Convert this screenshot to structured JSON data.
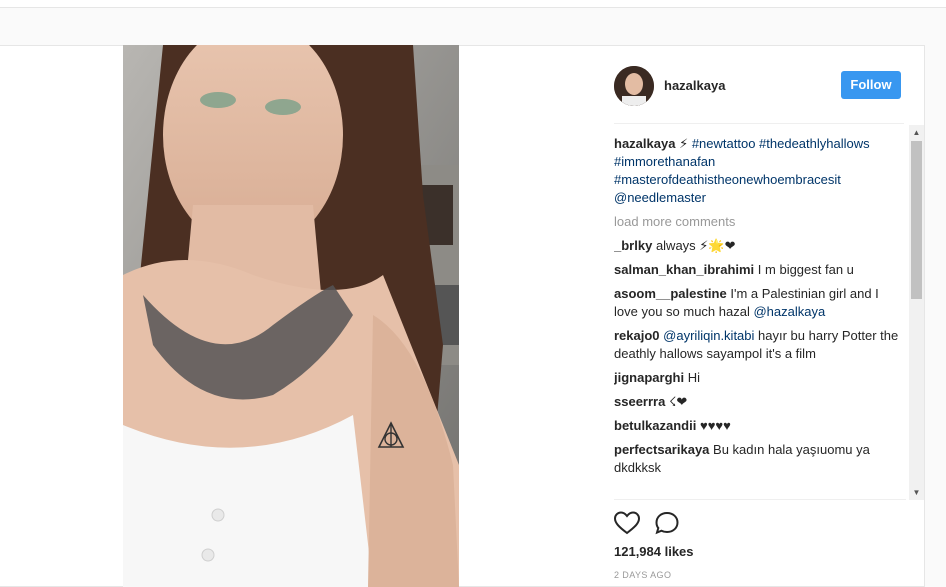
{
  "post": {
    "username": "hazalkaya",
    "follow_label": "Follow",
    "caption": {
      "username": "hazalkaya",
      "emoji": "⚡",
      "hashtags": "#newtattoo #thedeathlyhallows #immorethanafan #masterofdeathistheonewhoembracesit",
      "mention": "@needlemaster"
    },
    "load_more_label": "load more comments",
    "comments": [
      {
        "user": "_brlky",
        "text": "always ⚡🌟❤"
      },
      {
        "user": "salman_khan_ibrahimi",
        "text": "I m biggest fan u"
      },
      {
        "user": "asoom__palestine",
        "text": "I'm a Palestinian girl and I love you so much hazal",
        "mention": "@hazalkaya"
      },
      {
        "user": "rekajo0",
        "mention": "@ayriliqin.kitabi",
        "text": "hayır bu harry Potter the deathly hallows sayampol it's a film"
      },
      {
        "user": "jignaparghi",
        "text": "Hi"
      },
      {
        "user": "sseerrra",
        "text": "☇❤"
      },
      {
        "user": "betulkazandii",
        "text": "♥♥♥♥"
      },
      {
        "user": "perfectsarikaya",
        "text": "Bu kadın hala yaşıuomu ya dkdkksk"
      }
    ],
    "likes": "121,984 likes",
    "date": "2 DAYS AGO"
  },
  "icons": {
    "like": "heart-outline-icon",
    "comment": "speech-bubble-icon",
    "scroll_up": "arrow-up-icon",
    "scroll_down": "arrow-down-icon"
  },
  "colors": {
    "follow_button": "#3897f0",
    "link": "#003569",
    "muted": "#999999"
  }
}
